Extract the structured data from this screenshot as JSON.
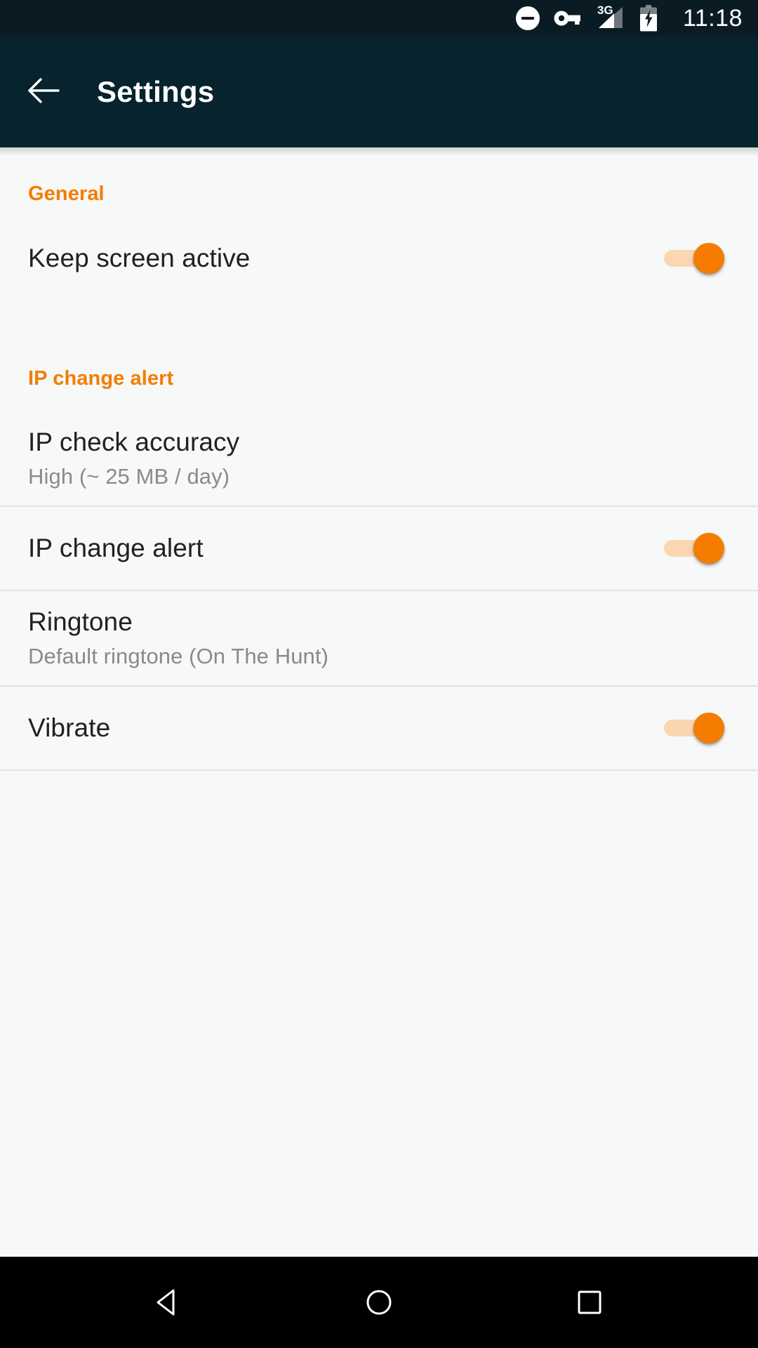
{
  "status_bar": {
    "time": "11:18",
    "network_label": "3G",
    "icons": [
      "do-not-disturb-icon",
      "vpn-key-icon",
      "signal-3g-icon",
      "battery-charging-icon"
    ],
    "background_color": "#0B1B24"
  },
  "app_bar": {
    "title": "Settings",
    "back_icon": "back-arrow-icon",
    "background_color": "#06232E",
    "title_color": "#FFFFFF"
  },
  "theme": {
    "accent_color": "#F57C00",
    "toggle_track_color": "#FAD7B0",
    "toggle_thumb_color": "#F57C00",
    "content_background": "#F7F8F8",
    "divider_color": "#E2E2E2",
    "primary_text_color": "#212121",
    "secondary_text_color": "#8A8A8A"
  },
  "sections": [
    {
      "header": "General",
      "rows": [
        {
          "title": "Keep screen active",
          "subtitle": "",
          "control": "toggle",
          "toggle_state": "on"
        }
      ]
    },
    {
      "header": "IP change alert",
      "rows": [
        {
          "title": "IP check accuracy",
          "subtitle": "High (~ 25 MB / day)",
          "control": "none",
          "toggle_state": ""
        },
        {
          "title": "IP change alert",
          "subtitle": "",
          "control": "toggle",
          "toggle_state": "on"
        },
        {
          "title": "Ringtone",
          "subtitle": "Default ringtone (On The Hunt)",
          "control": "none",
          "toggle_state": ""
        },
        {
          "title": "Vibrate",
          "subtitle": "",
          "control": "toggle",
          "toggle_state": "on"
        }
      ]
    }
  ],
  "nav_bar": {
    "back_label": "back-nav-icon",
    "home_label": "home-nav-icon",
    "recents_label": "recents-nav-icon",
    "background_color": "#000000"
  }
}
